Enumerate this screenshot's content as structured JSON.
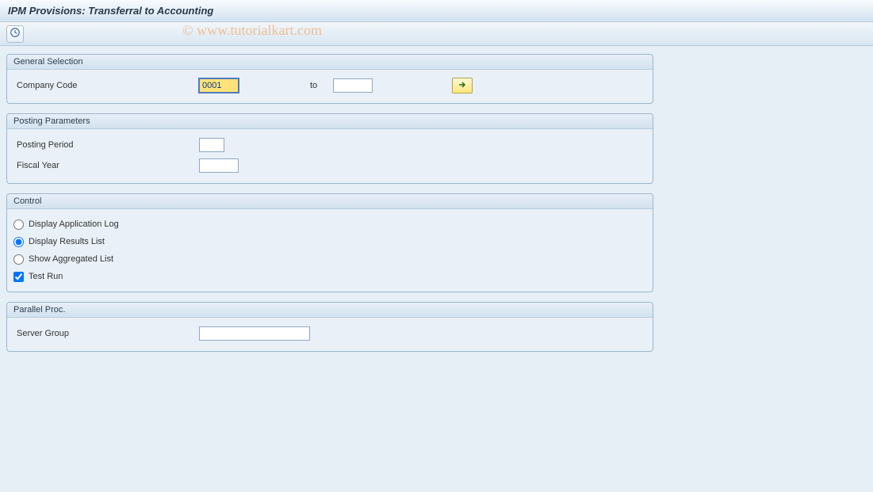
{
  "title": "IPM Provisions: Transferral to Accounting",
  "watermark": "© www.tutorialkart.com",
  "groups": {
    "general": {
      "title": "General Selection",
      "company_code_label": "Company Code",
      "company_code_from": "0001",
      "to_label": "to",
      "company_code_to": ""
    },
    "posting": {
      "title": "Posting Parameters",
      "period_label": "Posting Period",
      "period_value": "",
      "year_label": "Fiscal Year",
      "year_value": ""
    },
    "control": {
      "title": "Control",
      "opt_log": "Display Application Log",
      "opt_results": "Display Results List",
      "opt_aggregated": "Show Aggregated List",
      "chk_test": "Test Run"
    },
    "parallel": {
      "title": "Parallel Proc.",
      "server_label": "Server Group",
      "server_value": ""
    }
  }
}
